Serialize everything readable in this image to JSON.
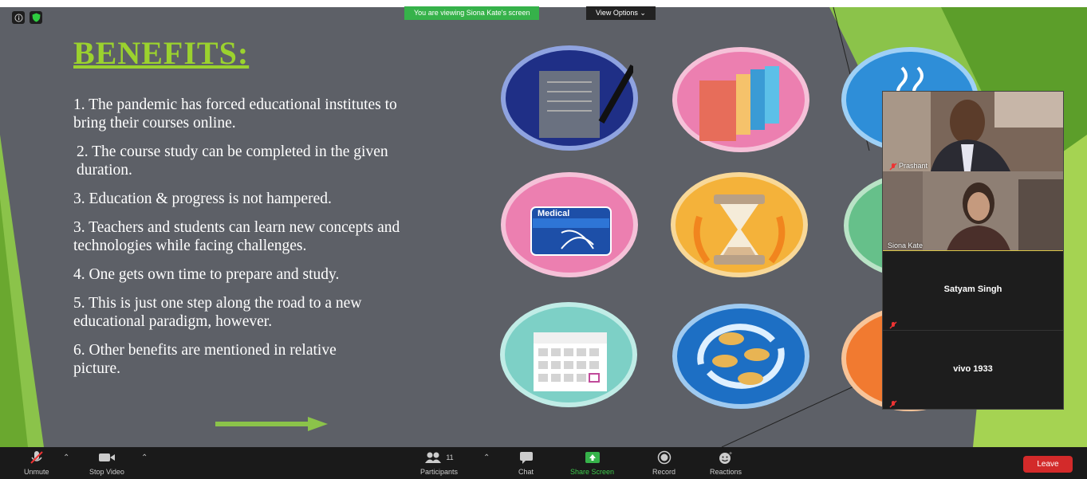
{
  "banner": {
    "sharing_text": "You are viewing Siona Kate's screen",
    "view_options": "View Options ⌄"
  },
  "slide": {
    "title": "BENEFITS:",
    "items": [
      "1. The pandemic has forced educational institutes to bring their courses online.",
      "2. The course study can be completed in the given duration.",
      "3. Education & progress is not hampered.",
      "3. Teachers and students can learn new concepts and technologies while facing challenges.",
      "4. One gets own time to prepare and study.",
      "5. This is just one step along the road to a new educational paradigm, however.",
      "6. Other benefits are mentioned in relative picture."
    ],
    "medical_label": "Medical",
    "colors": {
      "background": "#5d6067",
      "title": "#9bd22e",
      "accent_green": "#8bc34a"
    }
  },
  "participants_panel": {
    "tiles": [
      {
        "name": "Prashant",
        "video": true
      },
      {
        "name": "Siona Kate",
        "video": true
      },
      {
        "name": "Satyam Singh",
        "video": false,
        "muted": true
      },
      {
        "name": "vivo 1933",
        "video": false,
        "muted": true
      }
    ]
  },
  "toolbar": {
    "unmute": "Unmute",
    "stop_video": "Stop Video",
    "participants": "Participants",
    "participants_count": "11",
    "chat": "Chat",
    "share_screen": "Share Screen",
    "record": "Record",
    "reactions": "Reactions",
    "leave": "Leave"
  }
}
